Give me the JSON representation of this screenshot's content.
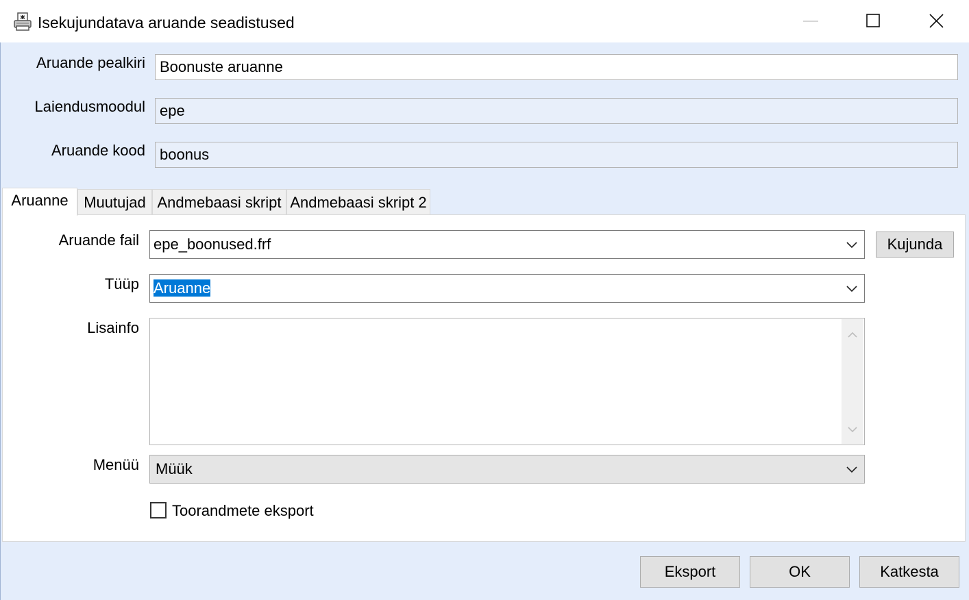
{
  "window": {
    "title": "Isekujundatava aruande seadistused",
    "icon": "report-printer-icon",
    "controls": [
      "minimize-icon",
      "maximize-icon",
      "close-icon"
    ]
  },
  "header_fields": {
    "title_label": "Aruande pealkiri",
    "title_value": "Boonuste aruanne",
    "module_label": "Laiendusmoodul",
    "module_value": "epe",
    "code_label": "Aruande kood",
    "code_value": "boonus"
  },
  "tabs": [
    {
      "label": "Aruanne",
      "active": true
    },
    {
      "label": "Muutujad",
      "active": false
    },
    {
      "label": "Andmebaasi skript",
      "active": false
    },
    {
      "label": "Andmebaasi skript 2",
      "active": false
    }
  ],
  "report_tab": {
    "file_label": "Aruande fail",
    "file_value": "epe_boonused.frf",
    "design_button": "Kujunda",
    "type_label": "Tüüp",
    "type_value": "Aruanne",
    "info_label": "Lisainfo",
    "info_value": "",
    "menu_label": "Menüü",
    "menu_value": "Müük",
    "export_checkbox_label": "Toorandmete eksport",
    "export_checked": false
  },
  "footer": {
    "export_button": "Eksport",
    "ok_button": "OK",
    "cancel_button": "Katkesta"
  },
  "colors": {
    "dialog_background": "#e4edfb",
    "selection": "#0078d7",
    "readonly_field": "#e8effa",
    "button_face": "#e1e1e1"
  }
}
